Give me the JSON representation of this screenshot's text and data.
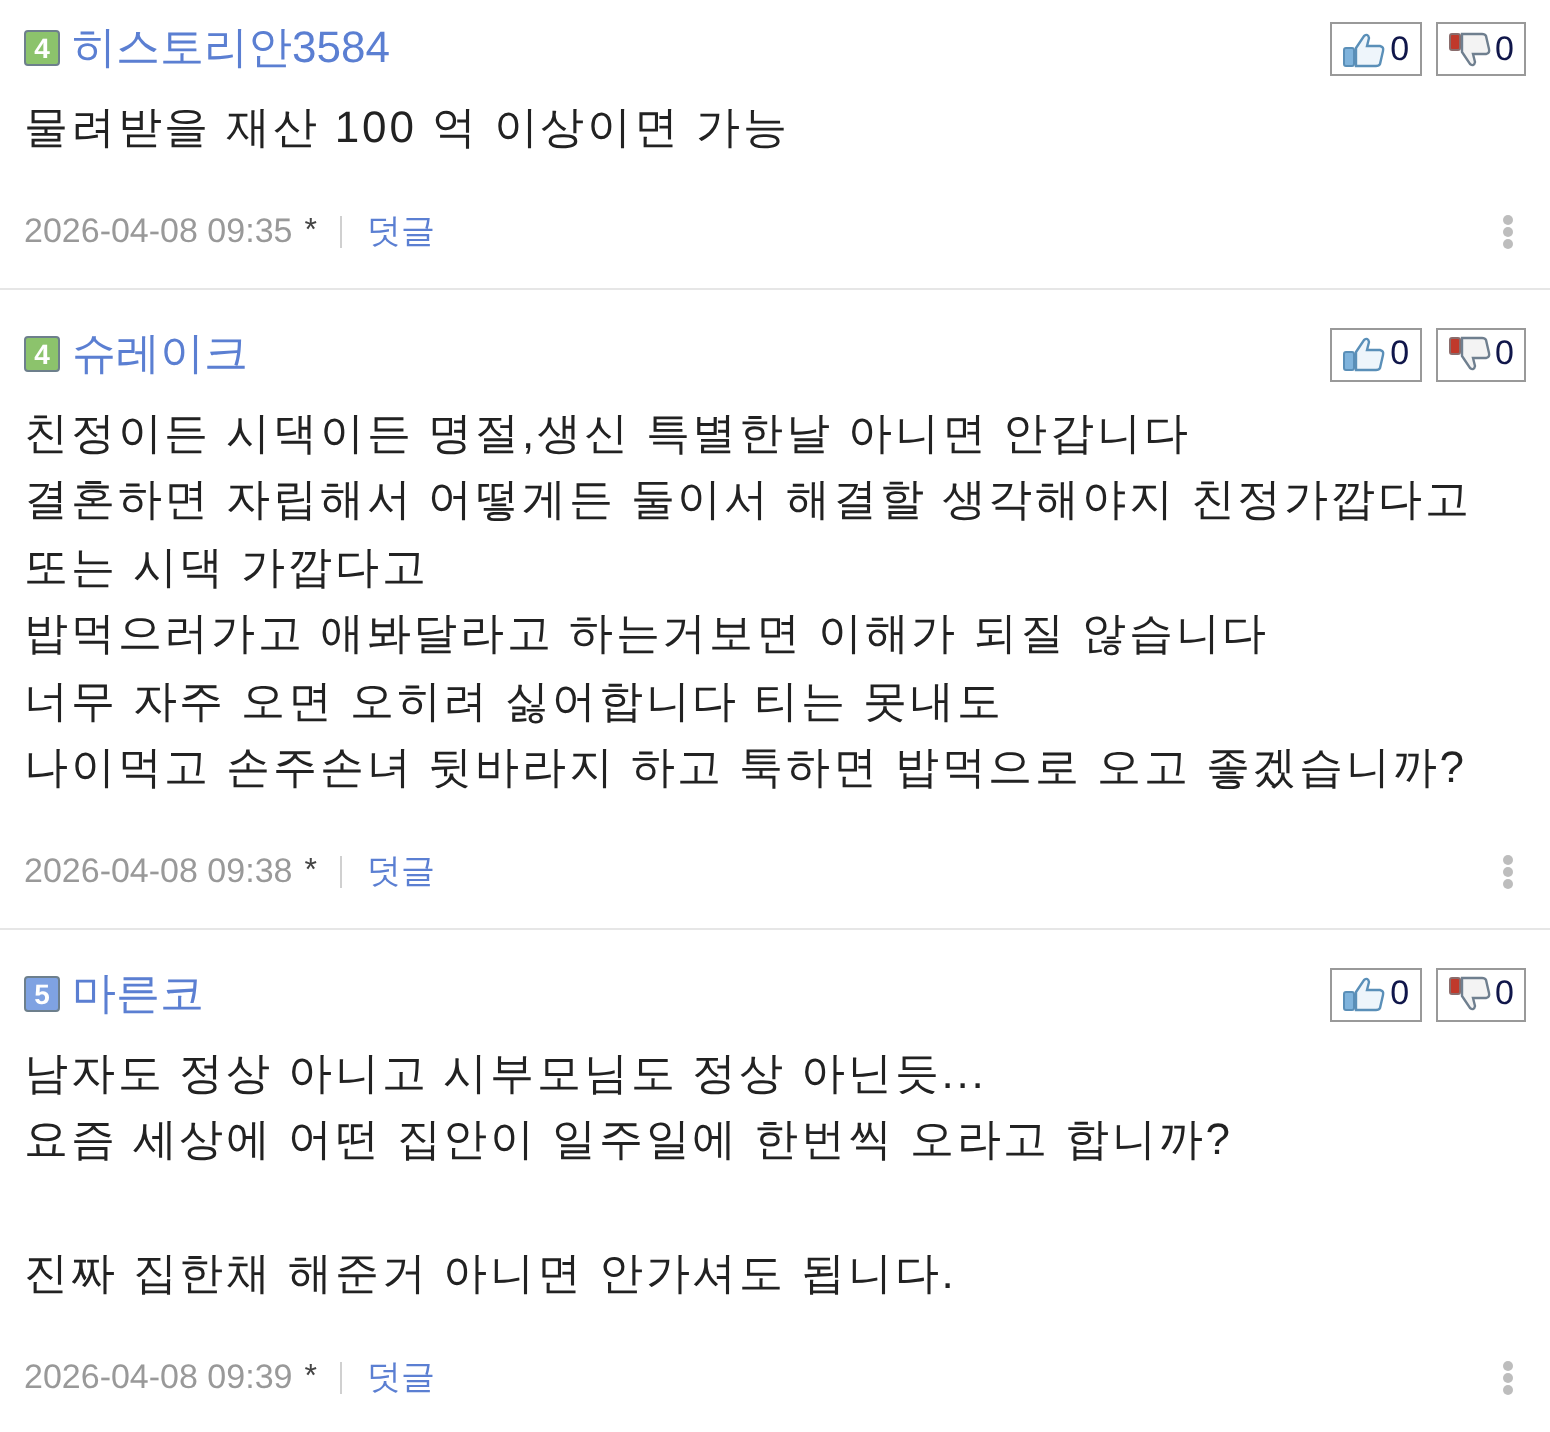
{
  "comments": [
    {
      "rank_badge": {
        "label": "4",
        "color": "#8cc36c"
      },
      "author": "히스토리안3584",
      "votes": {
        "up": "0",
        "down": "0"
      },
      "paragraphs": [
        [
          "물려받을 재산 100 억 이상이면 가능"
        ]
      ],
      "date": "2026-04-08 09:35",
      "mark": "*",
      "reply_link": "덧글"
    },
    {
      "rank_badge": {
        "label": "4",
        "color": "#8cc36c"
      },
      "author": "슈레이크",
      "votes": {
        "up": "0",
        "down": "0"
      },
      "paragraphs": [
        [
          "친정이든 시댁이든 명절,생신 특별한날 아니면 안갑니다",
          "결혼하면 자립해서 어떻게든 둘이서 해결할 생각해야지 친정가깝다고",
          "또는 시댁 가깝다고",
          "밥먹으러가고 애봐달라고 하는거보면 이해가 되질 않습니다",
          "너무 자주 오면 오히려 싫어합니다 티는 못내도",
          "나이먹고 손주손녀 뒷바라지 하고 툭하면 밥먹으로 오고 좋겠습니까?"
        ]
      ],
      "date": "2026-04-08 09:38",
      "mark": "*",
      "reply_link": "덧글"
    },
    {
      "rank_badge": {
        "label": "5",
        "color": "#7fa2e2"
      },
      "author": "마른코",
      "votes": {
        "up": "0",
        "down": "0"
      },
      "paragraphs": [
        [
          "남자도 정상 아니고 시부모님도 정상 아닌듯...",
          "요즘 세상에 어떤 집안이 일주일에 한번씩 오라고 합니까?"
        ],
        [
          "진짜 집한채 해준거 아니면 안가셔도 됩니다."
        ]
      ],
      "date": "2026-04-08 09:39",
      "mark": "*",
      "reply_link": "덧글"
    }
  ]
}
